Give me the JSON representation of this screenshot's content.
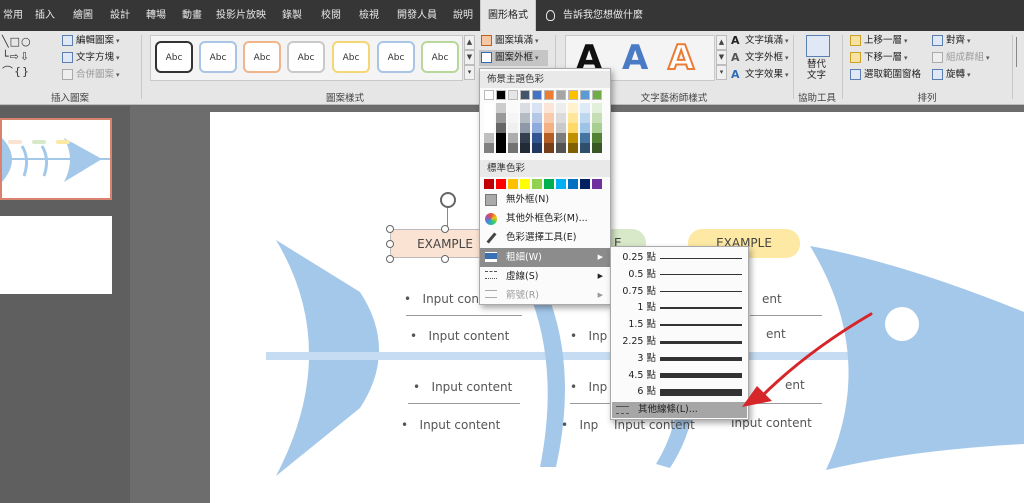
{
  "tabs": [
    "常用",
    "插入",
    "繪圖",
    "設計",
    "轉場",
    "動畫",
    "投影片放映",
    "錄製",
    "校閱",
    "檢視",
    "開發人員",
    "說明",
    "圖形格式"
  ],
  "tell_me": "告訴我您想做什麼",
  "ribbon": {
    "insert_shapes": {
      "edit_shape": "編輯圖案",
      "text_box": "文字方塊",
      "merge_shapes": "合併圖案",
      "label": "插入圖案"
    },
    "shape_styles": {
      "label": "圖案樣式",
      "abc": "Abc",
      "fill": "圖案填滿",
      "outline": "圖案外框"
    },
    "wordart": {
      "glyph": "A",
      "text_fill": "文字填滿",
      "text_outline": "文字外框",
      "text_effects": "文字效果",
      "label": "文字藝術師樣式"
    },
    "accessibility": {
      "alt_text_line1": "替代",
      "alt_text_line2": "文字",
      "label": "協助工具"
    },
    "arrange": {
      "bring_forward": "上移一層",
      "send_backward": "下移一層",
      "selection_pane": "選取範圍窗格",
      "align": "對齊",
      "group": "組成群組",
      "rotate": "旋轉",
      "label": "排列"
    }
  },
  "slide": {
    "labels": [
      "EXAMPLE",
      "E",
      "EXAMPLE"
    ],
    "contents": {
      "a": "Input content",
      "b": "Input content",
      "c": "Input content",
      "d": "Input content",
      "e": "Inp",
      "f": "Inp",
      "g": "Inp",
      "h": "Input content",
      "i": "ent",
      "j": "ent",
      "k": "ent",
      "l": "Input content"
    },
    "bullet": "•"
  },
  "outline_menu": {
    "theme_colors_title": "佈景主題色彩",
    "standard_colors_title": "標準色彩",
    "no_outline": "無外框(N)",
    "more_colors": "其他外框色彩(M)...",
    "eyedropper": "色彩選擇工具(E)",
    "weight": "粗細(W)",
    "dashes": "虛線(S)",
    "arrows": "箭號(R)",
    "theme_colors": [
      "#ffffff",
      "#000000",
      "#e7e6e6",
      "#44546a",
      "#4472c4",
      "#ed7d31",
      "#a5a5a5",
      "#ffc000",
      "#5b9bd5",
      "#70ad47"
    ],
    "standard_colors": [
      "#c00000",
      "#ff0000",
      "#ffc000",
      "#ffff00",
      "#92d050",
      "#00b050",
      "#00b0f0",
      "#0070c0",
      "#002060",
      "#7030a0"
    ]
  },
  "weight_menu": {
    "options": [
      "0.25 點",
      "0.5 點",
      "0.75 點",
      "1 點",
      "1.5 點",
      "2.25 點",
      "3 點",
      "4.5 點",
      "6 點"
    ],
    "more_lines": "其他線條(L)..."
  },
  "colors": {
    "tab_bar": "#363636",
    "ribbon": "#e6e6e6",
    "fish": "#a4c8ea",
    "pill_orange": "#fbe3d3",
    "pill_green": "#d7e9c8",
    "pill_yellow": "#fde9a4",
    "annotation_arrow": "#d7262a"
  }
}
